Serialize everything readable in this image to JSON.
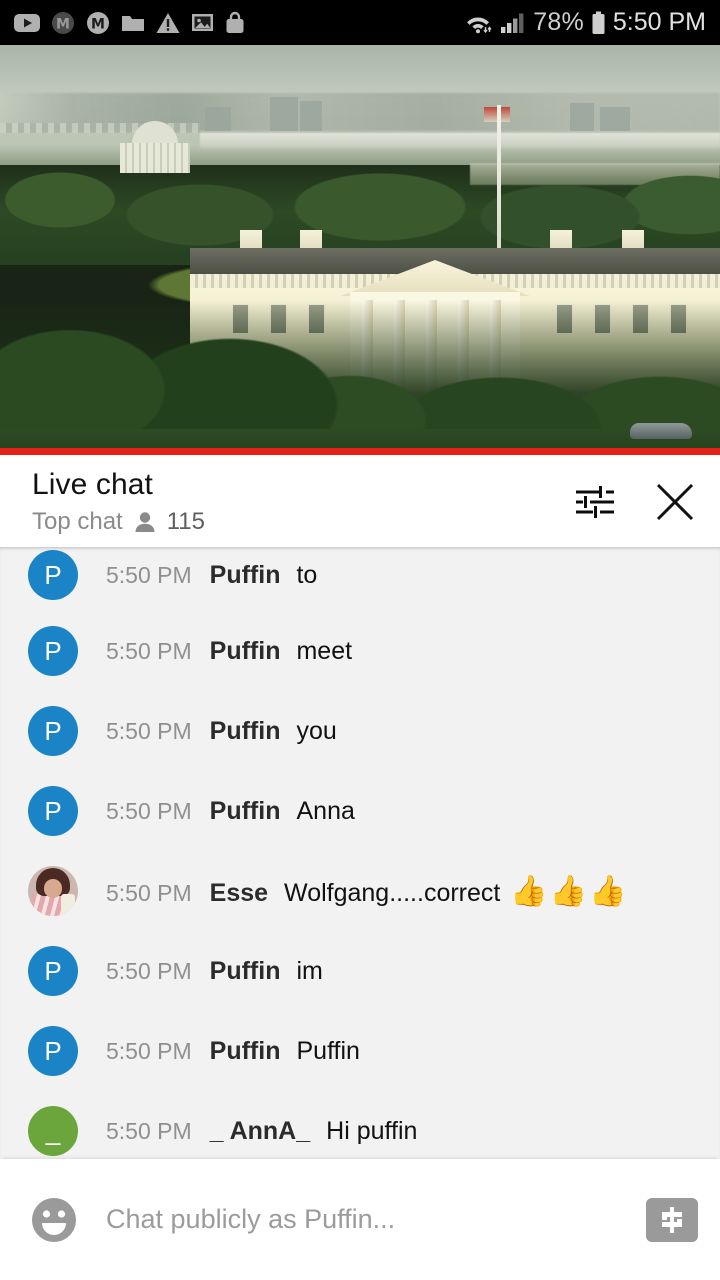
{
  "status_bar": {
    "left_icons": [
      {
        "name": "youtube-icon"
      },
      {
        "name": "m-badge-dark-icon"
      },
      {
        "name": "m-badge-icon"
      },
      {
        "name": "folder-icon"
      },
      {
        "name": "warning-triangle-icon"
      },
      {
        "name": "image-icon"
      },
      {
        "name": "shopping-bag-icon"
      }
    ],
    "wifi_icon": "wifi-icon",
    "signal_icon": "cellular-signal-icon",
    "battery_percent": "78%",
    "battery_icon": "battery-icon",
    "time": "5:50 PM"
  },
  "video": {
    "progress_percent": 100,
    "progress_color": "#e62117",
    "is_live": true
  },
  "chat_header": {
    "title": "Live chat",
    "subtitle": "Top chat",
    "viewer_count": "115",
    "viewer_icon": "person-icon",
    "settings_icon": "tune-sliders-icon",
    "close_icon": "close-x-icon"
  },
  "messages": [
    {
      "time": "5:50 PM",
      "author": "Puffin",
      "text": "to",
      "avatar": {
        "type": "initial",
        "letter": "P",
        "color": "#1a84c7"
      }
    },
    {
      "time": "5:50 PM",
      "author": "Puffin",
      "text": "meet",
      "avatar": {
        "type": "initial",
        "letter": "P",
        "color": "#1a84c7"
      }
    },
    {
      "time": "5:50 PM",
      "author": "Puffin",
      "text": "you",
      "avatar": {
        "type": "initial",
        "letter": "P",
        "color": "#1a84c7"
      }
    },
    {
      "time": "5:50 PM",
      "author": "Puffin",
      "text": "Anna",
      "avatar": {
        "type": "initial",
        "letter": "P",
        "color": "#1a84c7"
      }
    },
    {
      "time": "5:50 PM",
      "author": "Esse",
      "text": "Wolfgang.....correct",
      "emoji": "👍👍👍",
      "avatar": {
        "type": "photo"
      }
    },
    {
      "time": "5:50 PM",
      "author": "Puffin",
      "text": "im",
      "avatar": {
        "type": "initial",
        "letter": "P",
        "color": "#1a84c7"
      }
    },
    {
      "time": "5:50 PM",
      "author": "Puffin",
      "text": "Puffin",
      "avatar": {
        "type": "initial",
        "letter": "P",
        "color": "#1a84c7"
      }
    },
    {
      "time": "5:50 PM",
      "author": "_ AnnA_",
      "text": "Hi puffin",
      "avatar": {
        "type": "initial",
        "letter": "_",
        "color": "#6aa63b"
      }
    }
  ],
  "input_bar": {
    "emoji_icon": "emoji-smiley-icon",
    "placeholder": "Chat publicly as Puffin...",
    "value": "",
    "superchat_icon": "dollar-superchat-icon"
  }
}
